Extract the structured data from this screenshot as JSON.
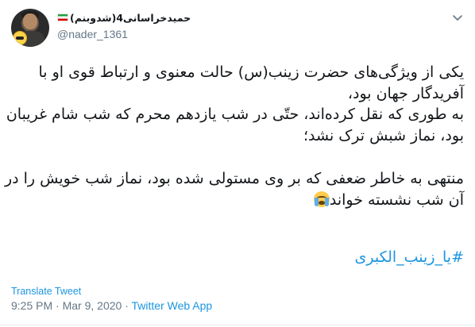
{
  "author": {
    "display_name": "حمیدخراسانی4(شدوبنم)",
    "handle": "@nader_1361"
  },
  "tweet": {
    "lines": [
      "یکی از ویژگی‌های حضرت زینب(س) حالت معنوی و ارتباط قوی او با",
      "آفریدگار جهان بود،",
      "به طوری که نقل کرده‌اند، حتّی در شب یازدهم محرم که شب شام غریبان",
      "بود، نماز شبش ترک نشد؛",
      "",
      "منتهی به خاطر ضعفی که بر وی مستولی شده بود، نماز شب خویش را در",
      "آن شب نشسته خواند"
    ],
    "emoji": "loudly-crying-face-icon",
    "hashtag": "#یا_زینب_الکبری"
  },
  "actions": {
    "translate": "Translate Tweet"
  },
  "meta": {
    "time": "9:25 PM",
    "date": "Mar 9, 2020",
    "separator": "·",
    "source": "Twitter Web App"
  },
  "colors": {
    "link": "#1b95e0",
    "muted": "#657786",
    "text": "#14171a"
  }
}
